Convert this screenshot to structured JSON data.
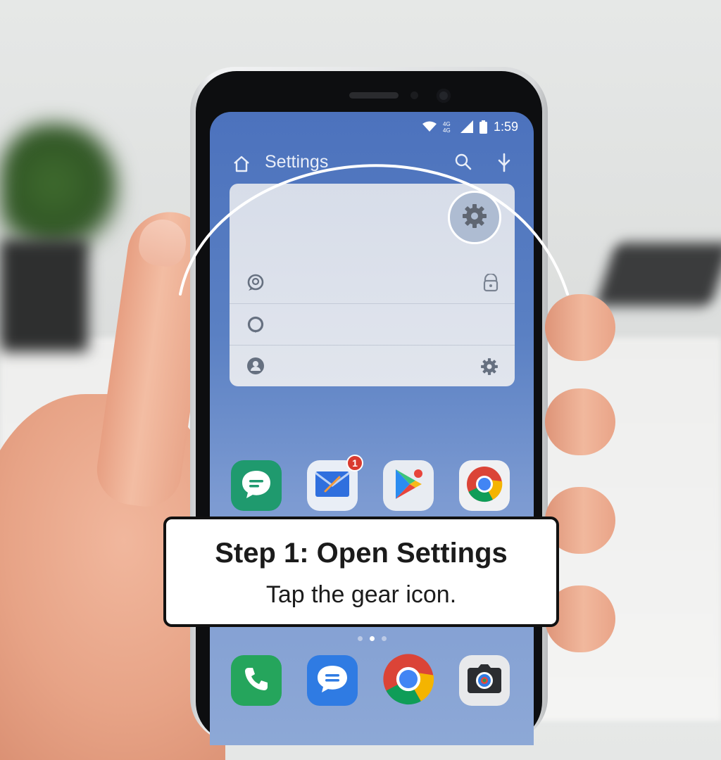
{
  "status_bar": {
    "time": "1:59",
    "icons": [
      "wifi-icon",
      "data-icon",
      "signal-icon",
      "battery-icon"
    ]
  },
  "app_bar": {
    "title": "Settings",
    "icons": [
      "home-icon",
      "search-icon",
      "mic-icon"
    ]
  },
  "panel": {
    "gear_icon": "gear-icon",
    "rows": [
      {
        "left_icon": "search-bubble-icon",
        "right_icon": "lock-icon"
      },
      {
        "left_icon": "circle-icon",
        "right_icon": ""
      },
      {
        "left_icon": "account-icon",
        "right_icon": "gear-icon"
      }
    ]
  },
  "home_row": [
    {
      "app": "messages-icon",
      "color": "#1f9a6e"
    },
    {
      "app": "mail-icon",
      "color": "#2f6fde",
      "badge": "1"
    },
    {
      "app": "play-store-icon",
      "color": "#e8ecf2"
    },
    {
      "app": "chrome-icon",
      "color": "#f0f1f3"
    }
  ],
  "dock": [
    {
      "app": "phone-icon",
      "color": "#25a55c"
    },
    {
      "app": "chat-icon",
      "color": "#2f7be3"
    },
    {
      "app": "chrome-icon",
      "color": "#ffffff"
    },
    {
      "app": "camera-icon",
      "color": "#e8e9eb"
    }
  ],
  "page_dots": {
    "count": 3,
    "active": 2
  },
  "callout": {
    "title": "Step 1: Open Settings",
    "subtitle": "Tap the gear icon."
  },
  "colors": {
    "accent_blue": "#4c72bd",
    "callout_border": "#111111"
  }
}
